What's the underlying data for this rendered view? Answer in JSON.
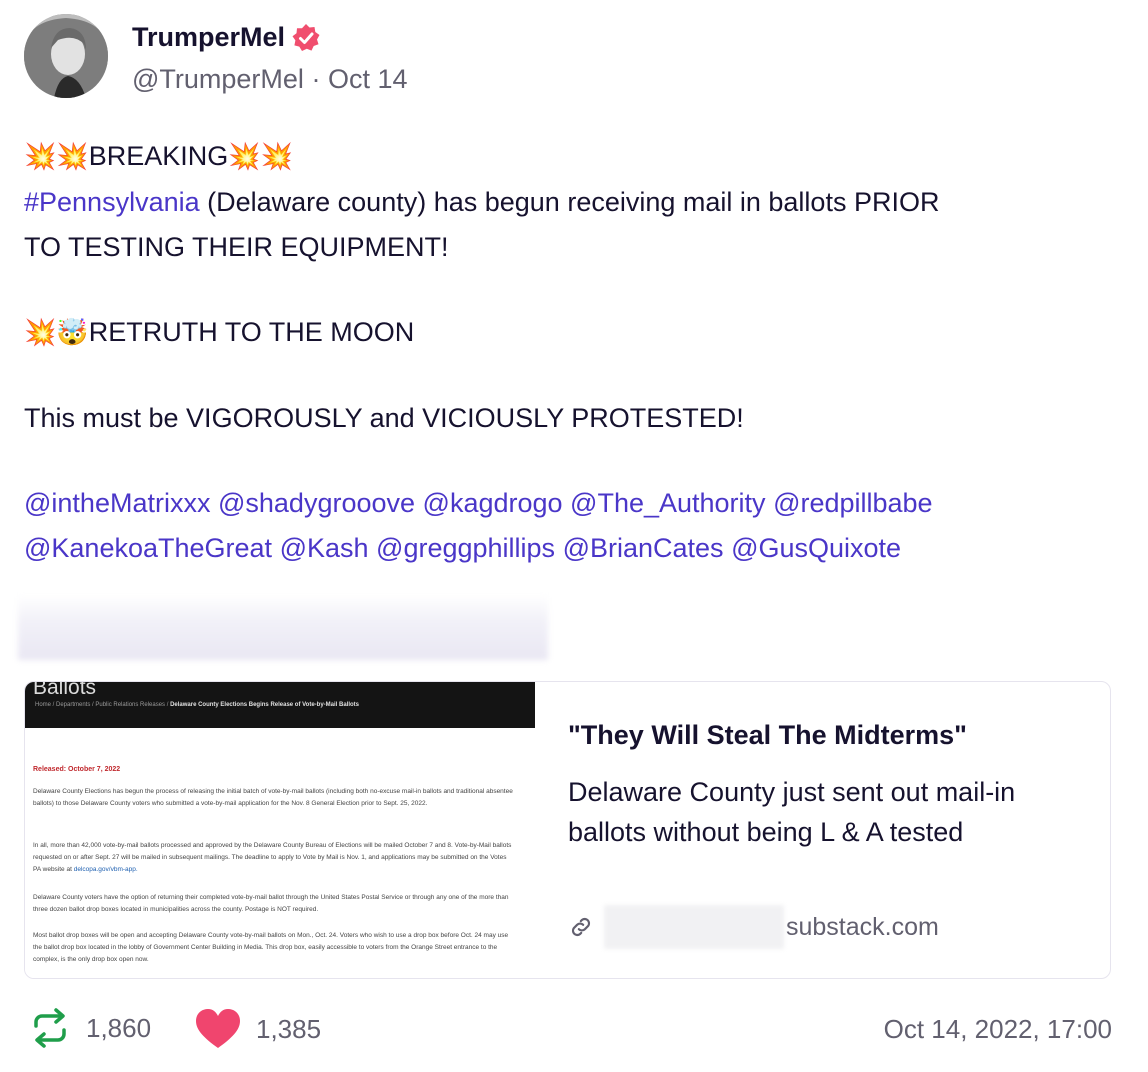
{
  "post": {
    "display_name": "TrumperMel",
    "handle": "@TrumperMel",
    "separator": "·",
    "date_short": "Oct 14",
    "verified": true,
    "lines": {
      "l1_emoji_pre": "💥💥",
      "l1_text": "BREAKING",
      "l1_emoji_post": "💥💥",
      "l2_hashtag": "#Pennsylvania",
      "l2_text": " (Delaware county) has begun receiving mail in ballots PRIOR",
      "l3_text": "TO TESTING THEIR EQUIPMENT!",
      "l4_emoji": "💥🤯",
      "l4_text": "RETRUTH TO THE MOON",
      "l5_text": "This must be VIGOROUSLY and VICIOUSLY PROTESTED!"
    },
    "mentions_row1": [
      "@intheMatrixxx",
      "@shadygrooove",
      "@kagdrogo",
      "@The_Authority",
      "@redpillbabe"
    ],
    "mentions_row2": [
      "@KanekoaTheGreat",
      "@Kash",
      "@greggphillips",
      "@BrianCates",
      "@GusQuixote"
    ]
  },
  "card": {
    "title": "\"They Will Steal The Midterms\"",
    "description": "Delaware County just sent out mail-in ballots without being L & A tested",
    "domain": "substack.com",
    "thumbnail": {
      "header": "Ballots",
      "breadcrumb": "Home / Departments / Public Relations Releases /",
      "breadcrumb_current": "Delaware County Elections Begins Release of Vote-by-Mail Ballots",
      "released": "Released: October 7, 2022",
      "p1": "Delaware County Elections has begun the process of releasing the initial batch of vote-by-mail ballots (including both no-excuse mail-in ballots and traditional absentee ballots) to those Delaware County voters who submitted a vote-by-mail application for the Nov. 8 General Election prior to Sept. 25, 2022.",
      "p2": "In all, more than 42,000 vote-by-mail ballots processed and approved by the Delaware County Bureau of Elections will be mailed October 7 and 8. Vote-by-Mail ballots requested on or after Sept. 27 will be mailed in subsequent mailings. The deadline to apply to Vote by Mail is Nov. 1, and applications may be submitted on the Votes PA website at",
      "p2_link": "delcopa.gov/vbm-app.",
      "p3": "Delaware County voters have the option of returning their completed vote-by-mail ballot through the United States Postal Service or through any one of the more than three dozen ballot drop boxes located in municipalities across the county. Postage is NOT required.",
      "p4": "Most ballot drop boxes will be open and accepting Delaware County vote-by-mail ballots on Mon., Oct. 24. Voters who wish to use a drop box before Oct. 24 may use the ballot drop box located in the lobby of Government Center Building in Media. This drop box, easily accessible to voters from the Orange Street entrance to the complex, is the only drop box open now."
    }
  },
  "stats": {
    "retruths": "1,860",
    "likes": "1,385",
    "timestamp": "Oct 14, 2022, 17:00"
  },
  "colors": {
    "accent": "#4a36c8",
    "verified": "#f04e6e",
    "retruth": "#1f9e4a",
    "like": "#f0456e",
    "muted": "#62606f"
  }
}
